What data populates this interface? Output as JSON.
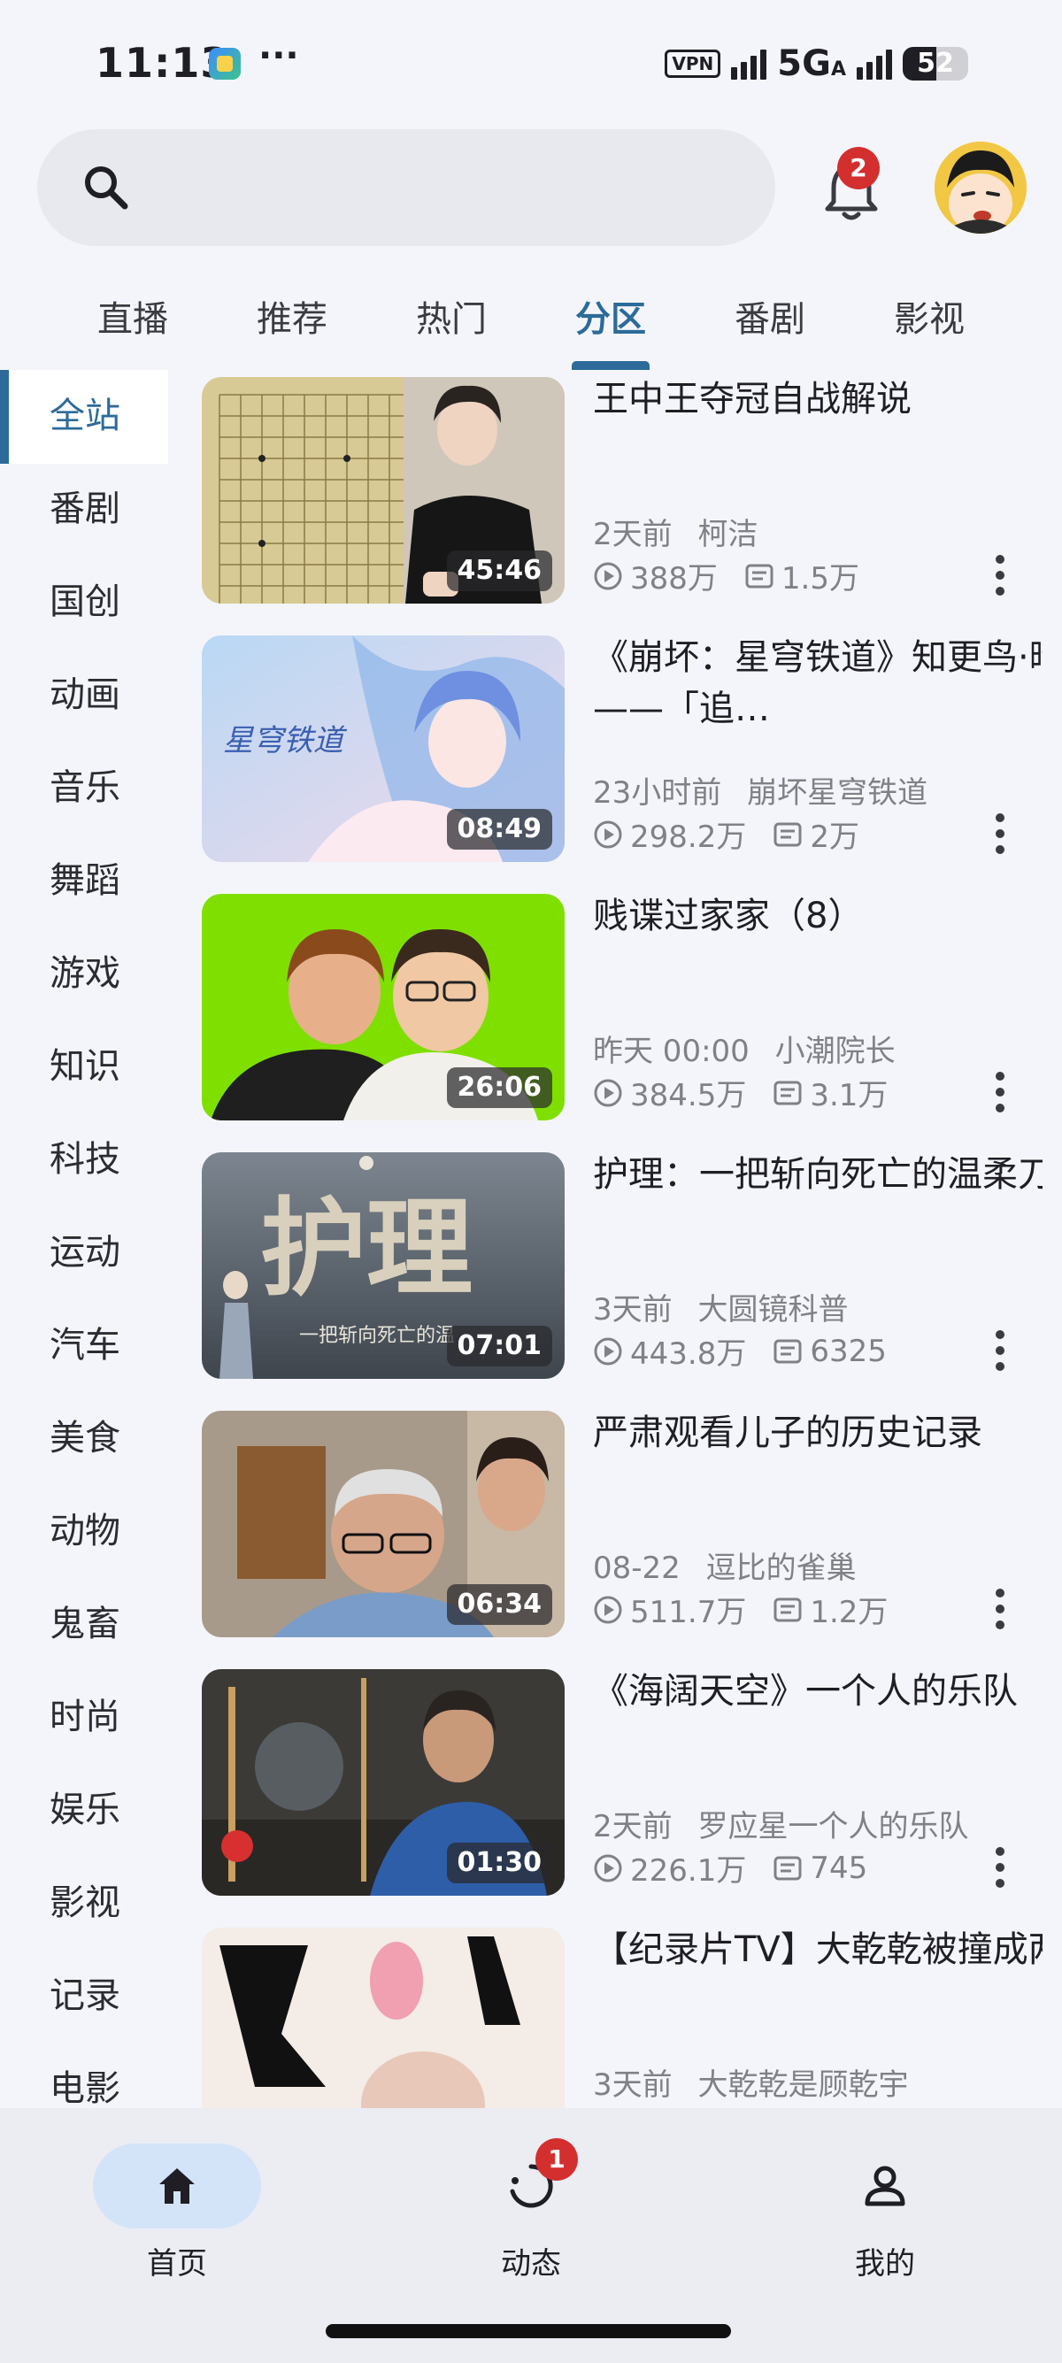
{
  "status_bar": {
    "time": "11:13",
    "dots": "···",
    "vpn": "VPN",
    "network": "5G",
    "network_suffix": "A",
    "battery": "52"
  },
  "header": {
    "notification_count": "2"
  },
  "tabs": [
    {
      "label": "直播"
    },
    {
      "label": "推荐"
    },
    {
      "label": "热门"
    },
    {
      "label": "分区",
      "active": true
    },
    {
      "label": "番剧"
    },
    {
      "label": "影视"
    }
  ],
  "sidebar": {
    "items": [
      {
        "label": "全站",
        "active": true
      },
      {
        "label": "番剧"
      },
      {
        "label": "国创"
      },
      {
        "label": "动画"
      },
      {
        "label": "音乐"
      },
      {
        "label": "舞蹈"
      },
      {
        "label": "游戏"
      },
      {
        "label": "知识"
      },
      {
        "label": "科技"
      },
      {
        "label": "运动"
      },
      {
        "label": "汽车"
      },
      {
        "label": "美食"
      },
      {
        "label": "动物"
      },
      {
        "label": "鬼畜"
      },
      {
        "label": "时尚"
      },
      {
        "label": "娱乐"
      },
      {
        "label": "影视"
      },
      {
        "label": "记录"
      },
      {
        "label": "电影"
      }
    ]
  },
  "videos": [
    {
      "title": "王中王夺冠自战解说",
      "duration": "45:46",
      "time": "2天前",
      "author": "柯洁",
      "views": "388万",
      "danmaku": "1.5万"
    },
    {
      "title": "《崩坏：星穹铁道》知更鸟·晴歌角色PV——「追…",
      "duration": "08:49",
      "time": "23小时前",
      "author": "崩坏星穹铁道",
      "views": "298.2万",
      "danmaku": "2万"
    },
    {
      "title": "贱谍过家家（8）",
      "duration": "26:06",
      "time": "昨天 00:00",
      "author": "小潮院长",
      "views": "384.5万",
      "danmaku": "3.1万"
    },
    {
      "title": "护理：一把斩向死亡的温柔刀",
      "duration": "07:01",
      "time": "3天前",
      "author": "大圆镜科普",
      "views": "443.8万",
      "danmaku": "6325"
    },
    {
      "title": "严肃观看儿子的历史记录",
      "duration": "06:34",
      "time": "08-22",
      "author": "逗比的雀巢",
      "views": "511.7万",
      "danmaku": "1.2万"
    },
    {
      "title": "《海阔天空》一个人的乐队",
      "duration": "01:30",
      "time": "2天前",
      "author": "罗应星一个人的乐队",
      "views": "226.1万",
      "danmaku": "745"
    },
    {
      "title": "【纪录片TV】大乾乾被撞成两半了……",
      "duration": "",
      "time": "3天前",
      "author": "大乾乾是顾乾宇",
      "views": "",
      "danmaku": ""
    }
  ],
  "bottom_nav": {
    "home": "首页",
    "dynamic": "动态",
    "dynamic_badge": "1",
    "mine": "我的"
  },
  "colors": {
    "accent": "#2c6b99",
    "badge": "#d32f2f",
    "background": "#f4f5fa"
  }
}
